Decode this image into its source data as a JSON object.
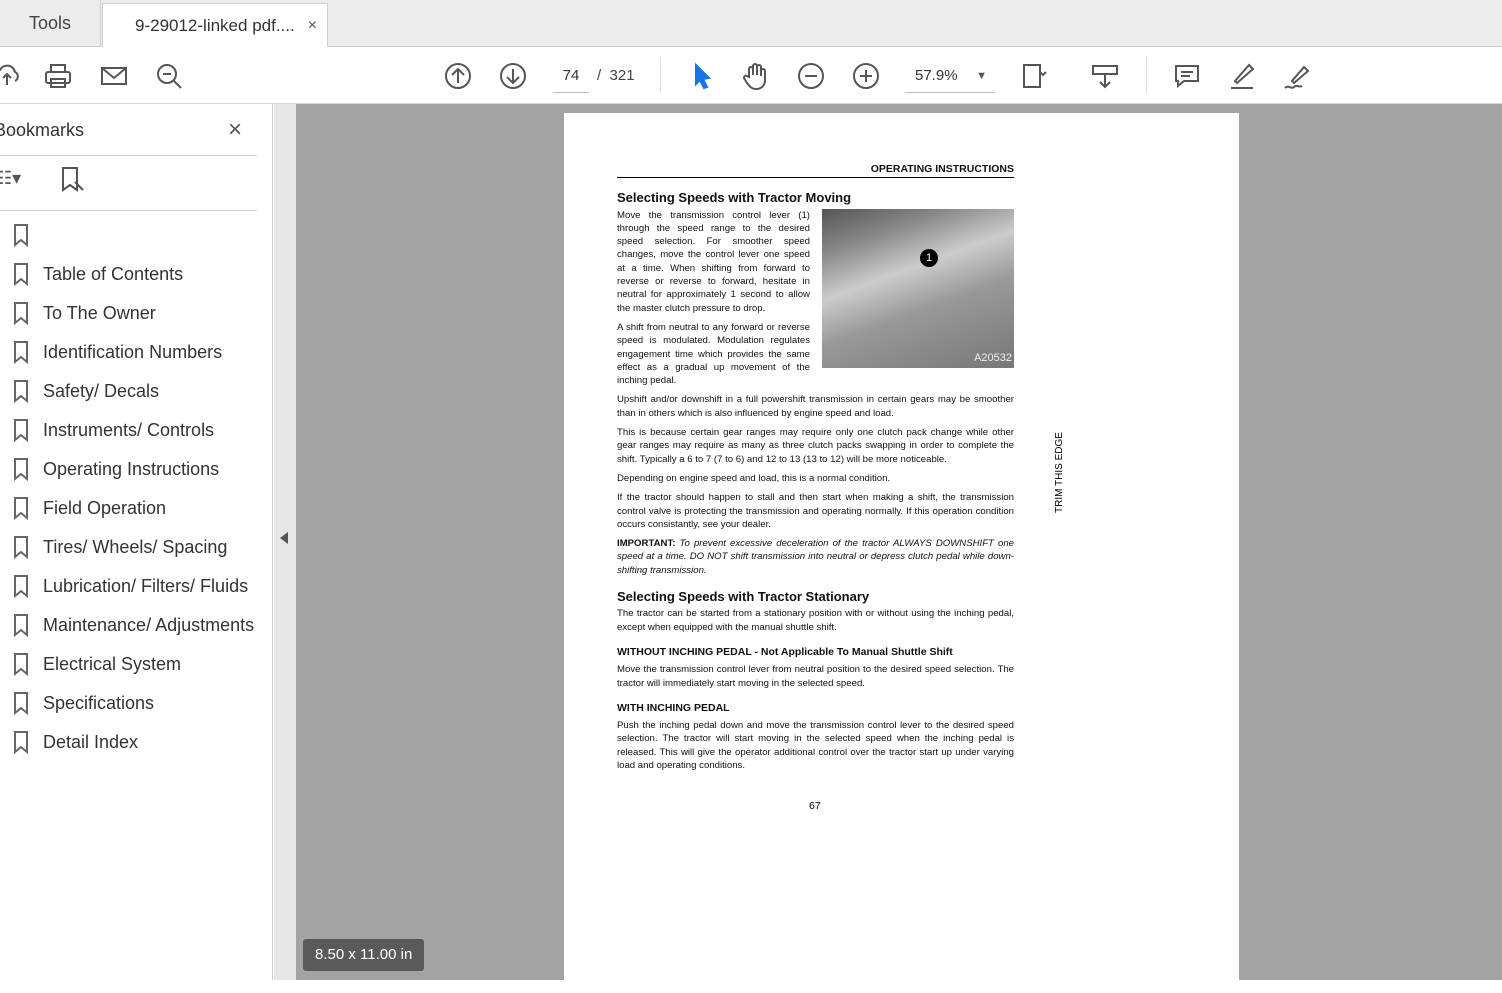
{
  "tabs": {
    "tools": "Tools",
    "document": "9-29012-linked pdf....",
    "close": "×"
  },
  "toolbar": {
    "page_current": "74",
    "page_separator": "/",
    "page_total": "321",
    "zoom": "57.9%"
  },
  "sidebar": {
    "title": "Bookmarks",
    "close": "×",
    "bookmarks": [
      "",
      "Table of Contents",
      "To The Owner",
      "Identification Numbers",
      "Safety/ Decals",
      "Instruments/ Controls",
      "Operating Instructions",
      "Field Operation",
      "Tires/ Wheels/ Spacing",
      "Lubrication/ Filters/ Fluids",
      "Maintenance/ Adjustments",
      "Electrical System",
      "Specifications",
      "Detail Index"
    ]
  },
  "page": {
    "running_head": "OPERATING INSTRUCTIONS",
    "h1": "Selecting Speeds with Tractor Moving",
    "p1": "Move the transmission control lever (1) through the speed range to the desired speed selection. For smoother speed changes, move the control lever one speed at a time. When shifting from forward to reverse or reverse to forward, hesitate in neutral for approximately 1 second to allow the master clutch pressure to drop.",
    "p2": "A shift from neutral to any forward or reverse speed is modulated. Modulation regulates engagement time which provides the same effect as a gradual up movement of the inching pedal.",
    "photo_callout": "1",
    "photo_label": "A20532",
    "p3": "Upshift and/or downshift in a full powershift transmission in certain gears may be smoother than in others which is also influenced by engine speed and load.",
    "p4": "This is because certain gear ranges may require only one clutch pack change while other gear ranges may require as many as three clutch packs swapping in order to complete the shift. Typically a 6 to 7 (7 to 6) and 12 to 13 (13 to 12) will be more noticeable.",
    "p5": "Depending on engine speed and load, this is a normal condition.",
    "p6": "If the tractor should happen to stall and then start when making a shift, the transmission control valve is protecting the transmission and operating normally. If this operation condition occurs consistantly, see your dealer.",
    "important_label": "IMPORTANT:",
    "important_text": "To prevent excessive deceleration of the tractor ALWAYS DOWNSHIFT one speed at a time. DO NOT shift transmission into neutral or depress clutch pedal while down-shifting transmission.",
    "h2": "Selecting Speeds with Tractor Stationary",
    "p7": "The tractor can be started from a stationary position with or without using the inching pedal, except when equipped with the manual shuttle shift.",
    "h3a": "WITHOUT INCHING PEDAL - Not Applicable To Manual Shuttle Shift",
    "p8": "Move the transmission control lever from neutral position to the desired speed selection. The tractor will immediately start moving in the selected speed.",
    "h3b": "WITH INCHING PEDAL",
    "p9": "Push the inching pedal down and move the transmission control lever to the desired speed selection. The tractor will start moving in the selected speed when the inching pedal is released. This will give the operator additional control over the tractor start up under varying load and operating conditions.",
    "side_note": "TRIM THIS EDGE",
    "page_number": "67"
  },
  "page_size": "8.50 x 11.00 in"
}
